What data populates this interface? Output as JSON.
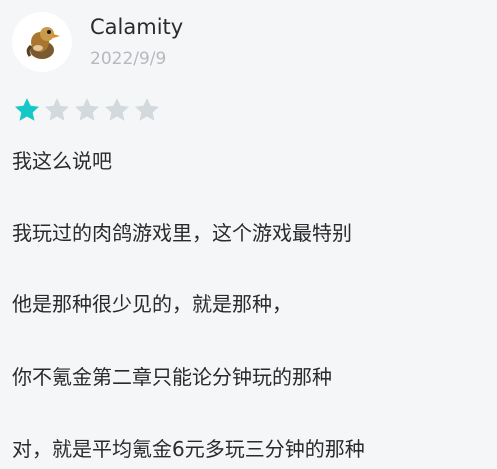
{
  "review": {
    "username": "Calamity",
    "date": "2022/9/9",
    "rating": {
      "value": 1,
      "max": 5,
      "filled_color": "#14c8c8",
      "empty_color": "#d3dadd"
    },
    "avatar_icon": "goose-avatar-icon",
    "lines": [
      "我这么说吧",
      "我玩过的肉鸽游戏里，这个游戏最特别",
      "他是那种很少见的，就是那种，",
      "你不氪金第二章只能论分钟玩的那种",
      "对，就是平均氪金6元多玩三分钟的那种"
    ]
  }
}
